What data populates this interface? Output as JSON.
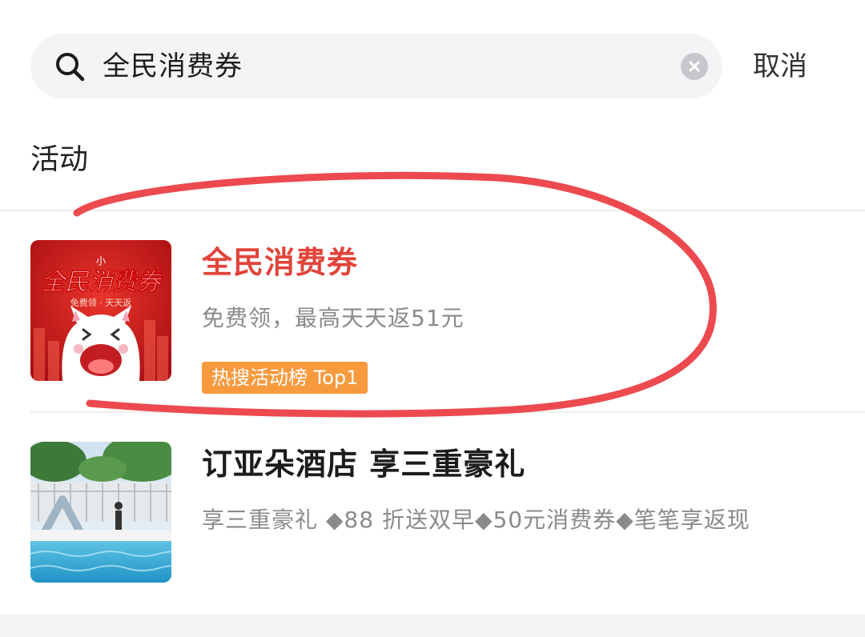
{
  "search": {
    "query": "全民消费券",
    "cancel_label": "取消"
  },
  "section": {
    "title": "活动"
  },
  "results": [
    {
      "title": "全民消费券",
      "description": "免费领，最高天天返51元",
      "tag": "热搜活动榜 Top1",
      "thumbnail": {
        "heading": "全民消费券",
        "subheading": "免费领 · 天天返",
        "badge": "小"
      }
    },
    {
      "title": "订亚朵酒店 享三重豪礼",
      "description": "享三重豪礼 ◆88 折送双早◆50元消费券◆笔笔享返现"
    }
  ],
  "colors": {
    "highlight_title": "#e0443a",
    "tag_background": "#f79a3e",
    "annotation_stroke": "#ec4a4f"
  },
  "icons": [
    "search-icon",
    "clear-icon",
    "cat-mascot-icon",
    "pool-icon"
  ]
}
